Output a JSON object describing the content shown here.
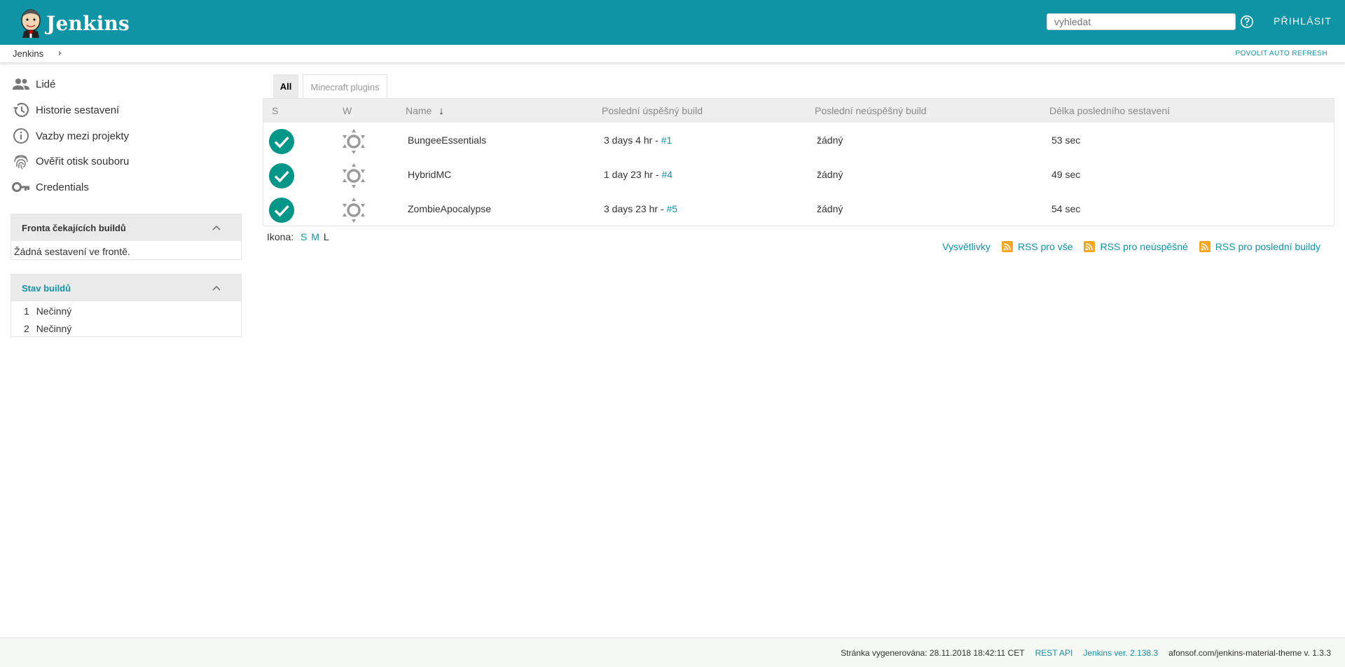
{
  "header": {
    "brand": "Jenkins",
    "search_placeholder": "vyhledat",
    "login_label": "PŘIHLÁSIT"
  },
  "breadcrumb": {
    "items": [
      "Jenkins"
    ],
    "auto_refresh": "POVOLIT AUTO REFRESH"
  },
  "sidebar": {
    "tasks": [
      {
        "label": "Lidé",
        "icon": "people-icon"
      },
      {
        "label": "Historie sestavení",
        "icon": "history-icon"
      },
      {
        "label": "Vazby mezi projekty",
        "icon": "info-icon"
      },
      {
        "label": "Ověřit otisk souboru",
        "icon": "fingerprint-icon"
      },
      {
        "label": "Credentials",
        "icon": "key-icon"
      }
    ],
    "queue": {
      "title": "Fronta čekajících buildů",
      "empty": "Žádná sestavení ve frontě."
    },
    "executors": {
      "title": "Stav buildů",
      "items": [
        {
          "num": "1",
          "status": "Nečinný"
        },
        {
          "num": "2",
          "status": "Nečinný"
        }
      ]
    }
  },
  "tabs": [
    {
      "label": "All",
      "active": true
    },
    {
      "label": "Minecraft plugins",
      "active": false
    }
  ],
  "table": {
    "headers": {
      "s": "S",
      "w": "W",
      "name": "Name",
      "sort_arrow": "↓",
      "last_success": "Poslední úspěšný build",
      "last_failure": "Poslední neúspěšný build",
      "last_duration": "Délka posledního sestavení"
    },
    "rows": [
      {
        "name": "BungeeEssentials",
        "success_time": "3 days 4 hr - ",
        "success_build": "#1",
        "failure": "žádný",
        "duration": "53 sec",
        "status": "success",
        "weather": "sunny"
      },
      {
        "name": "HybridMC",
        "success_time": "1 day 23 hr - ",
        "success_build": "#4",
        "failure": "žádný",
        "duration": "49 sec",
        "status": "success",
        "weather": "sunny"
      },
      {
        "name": "ZombieApocalypse",
        "success_time": "3 days 23 hr - ",
        "success_build": "#5",
        "failure": "žádný",
        "duration": "54 sec",
        "status": "success",
        "weather": "sunny"
      }
    ]
  },
  "icon_size": {
    "label": "Ikona:",
    "s": "S",
    "m": "M",
    "l": "L"
  },
  "legend": {
    "legend": "Vysvětlivky",
    "rss_all": "RSS pro vše",
    "rss_failed": "RSS pro neúspěšné",
    "rss_latest": "RSS pro poslední buildy"
  },
  "footer": {
    "generated": "Stránka vygenerována: 28.11.2018 18:42:11 CET",
    "rest_api": "REST API",
    "version": "Jenkins ver. 2.138.3",
    "theme": "afonsof.com/jenkins-material-theme v. 1.3.3"
  },
  "colors": {
    "accent": "#0f94a6",
    "success": "#009688",
    "rss": "#f5a623"
  }
}
